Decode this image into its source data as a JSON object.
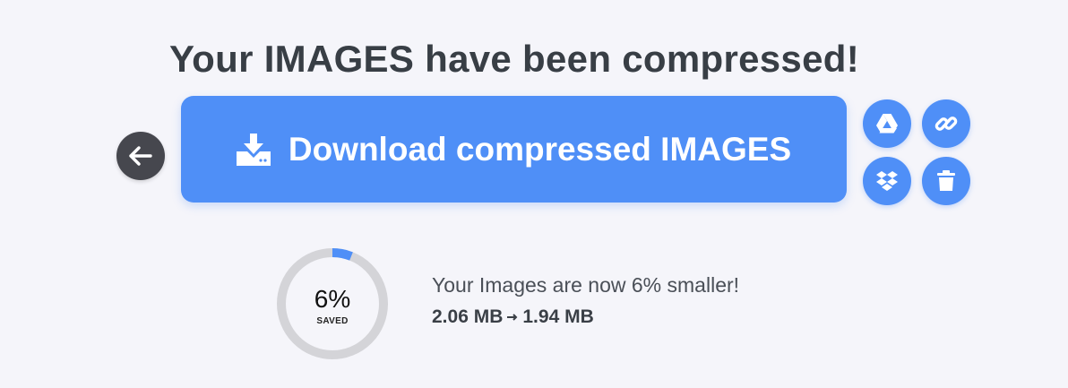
{
  "header": {
    "title": "Your IMAGES have been compressed!"
  },
  "actions": {
    "download_label": "Download compressed IMAGES",
    "back_icon": "arrow-left-icon",
    "side_buttons": [
      "google-drive-icon",
      "link-icon",
      "dropbox-icon",
      "trash-icon"
    ]
  },
  "result": {
    "percent_saved": 6,
    "percent_label": "6%",
    "saved_label": "SAVED",
    "summary": "Your Images are now 6% smaller!",
    "original_size": "2.06 MB",
    "compressed_size": "1.94 MB"
  },
  "colors": {
    "accent": "#4f8ff7",
    "back_button": "#46474e",
    "background": "#f5f5fa",
    "gauge_track": "#d4d4d8"
  }
}
